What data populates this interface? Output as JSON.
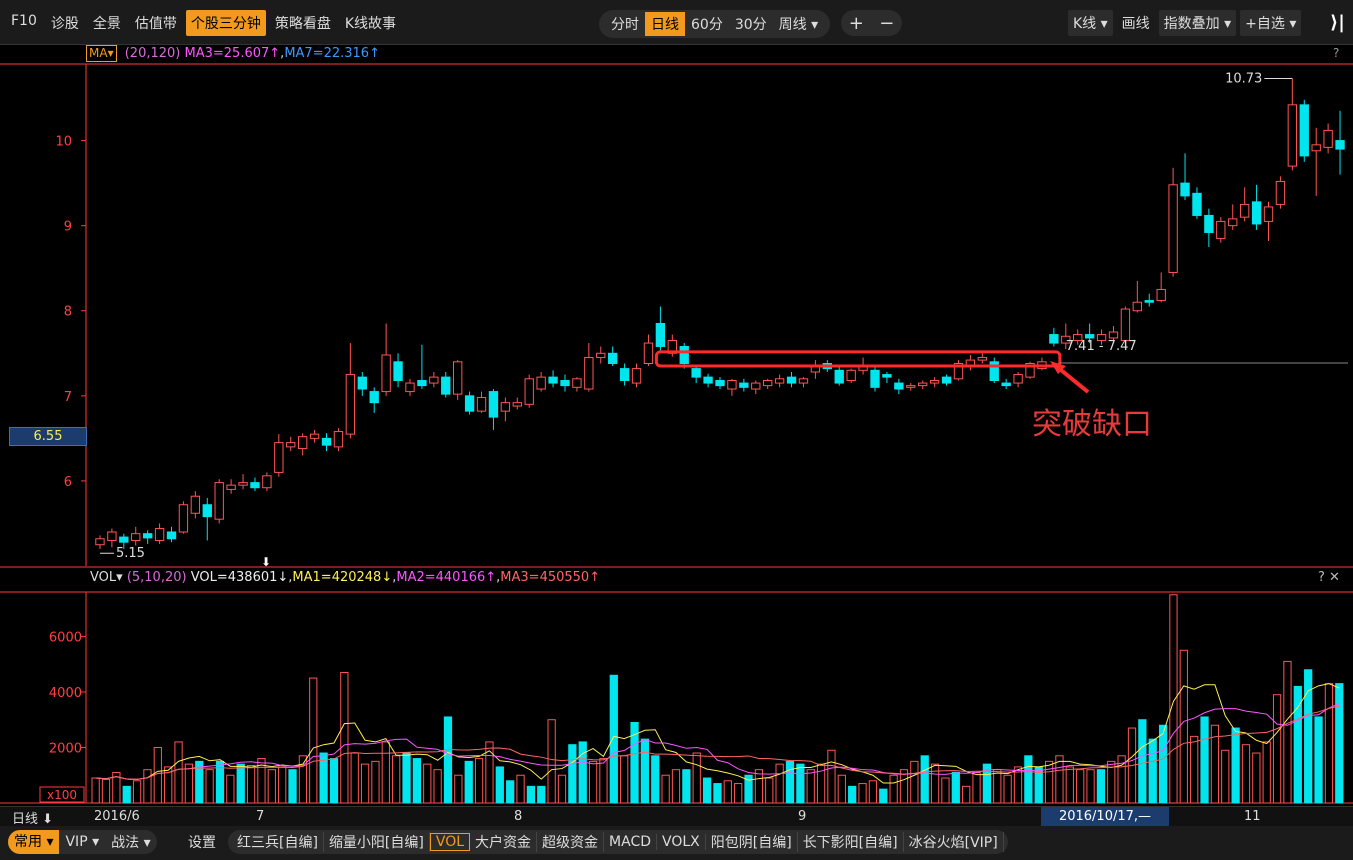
{
  "nav": {
    "items": [
      "F10",
      "诊股",
      "全景",
      "估值带",
      "个股三分钟",
      "策略看盘",
      "K线故事"
    ],
    "active": 4
  },
  "periods": {
    "items": [
      "分时",
      "日线",
      "60分",
      "30分",
      "周线 ▾"
    ],
    "active": 1
  },
  "zoom": {
    "in": "+",
    "out": "−"
  },
  "right_controls": {
    "kline": "K线 ▾",
    "draw": "画线",
    "index_overlay": "指数叠加 ▾",
    "add_watch": "+自选 ▾",
    "collapse": "⟩|"
  },
  "main_chart": {
    "indicator_button": "MA▾",
    "params": "(20,120)",
    "ma3": "MA3=25.607↑",
    "ma7": "MA7=22.316↑",
    "help": "?",
    "current_price_tag": "6.55",
    "high_label": "10.73",
    "low_label": "5.15",
    "gap_label": "7.41 - 7.47",
    "annotation": "突破缺口",
    "colors": {
      "up": "#ff5555",
      "down": "#00e5ee",
      "ma_a": "#ffee55",
      "ma_b": "#ff55ff",
      "ma_c": "#ff6666",
      "axis": "#ff3b3b",
      "gap_box": "#ff2a2a"
    }
  },
  "volume": {
    "label": "VOL▾",
    "params": "(5,10,20)",
    "vol": "VOL=438601↓",
    "ma1": "MA1=420248↓",
    "ma2": "MA2=440166↑",
    "ma3": "MA3=450550↑",
    "controls": "? ✕",
    "unit": "x100"
  },
  "dates": {
    "prefix": "日线 ⬇",
    "start": "2016/6",
    "m7": "7",
    "m8": "8",
    "m9": "9",
    "cursor": "2016/10/17,—",
    "m11": "11"
  },
  "bottom": {
    "group1": [
      "常用 ▾",
      "VIP ▾",
      "战法 ▾"
    ],
    "group1_active": 0,
    "settings": "设置",
    "indicators": [
      "红三兵[自编]",
      "缩量小阳[自编]",
      "VOL",
      "大户资金",
      "超级资金",
      "MACD",
      "VOLX",
      "阳包阴[自编]",
      "长下影阳[自编]",
      "冰谷火焰[VIP]"
    ],
    "indicators_active": 2
  },
  "chart_data": [
    {
      "type": "candlestick",
      "title": "",
      "ylim": [
        5.0,
        10.9
      ],
      "yticks": [
        6,
        7,
        8,
        9,
        10
      ],
      "grid": false,
      "max_annotation": 10.73,
      "min_annotation": 5.15,
      "gap_range": [
        7.41,
        7.47
      ],
      "candles": [
        {
          "o": 5.25,
          "c": 5.32,
          "h": 5.36,
          "l": 5.2
        },
        {
          "o": 5.3,
          "c": 5.4,
          "h": 5.44,
          "l": 5.22
        },
        {
          "o": 5.34,
          "c": 5.28,
          "h": 5.38,
          "l": 5.2
        },
        {
          "o": 5.3,
          "c": 5.38,
          "h": 5.46,
          "l": 5.24
        },
        {
          "o": 5.38,
          "c": 5.33,
          "h": 5.42,
          "l": 5.26
        },
        {
          "o": 5.3,
          "c": 5.44,
          "h": 5.5,
          "l": 5.26
        },
        {
          "o": 5.4,
          "c": 5.32,
          "h": 5.46,
          "l": 5.28
        },
        {
          "o": 5.4,
          "c": 5.72,
          "h": 5.76,
          "l": 5.38
        },
        {
          "o": 5.62,
          "c": 5.82,
          "h": 5.88,
          "l": 5.56
        },
        {
          "o": 5.72,
          "c": 5.58,
          "h": 5.8,
          "l": 5.3
        },
        {
          "o": 5.55,
          "c": 5.98,
          "h": 6.02,
          "l": 5.5
        },
        {
          "o": 5.9,
          "c": 5.95,
          "h": 6.02,
          "l": 5.85
        },
        {
          "o": 5.95,
          "c": 5.98,
          "h": 6.08,
          "l": 5.9
        },
        {
          "o": 5.98,
          "c": 5.92,
          "h": 6.04,
          "l": 5.88
        },
        {
          "o": 5.92,
          "c": 6.06,
          "h": 6.1,
          "l": 5.88
        },
        {
          "o": 6.1,
          "c": 6.45,
          "h": 6.55,
          "l": 6.05
        },
        {
          "o": 6.4,
          "c": 6.45,
          "h": 6.52,
          "l": 6.35
        },
        {
          "o": 6.38,
          "c": 6.52,
          "h": 6.56,
          "l": 6.3
        },
        {
          "o": 6.5,
          "c": 6.55,
          "h": 6.6,
          "l": 6.45
        },
        {
          "o": 6.5,
          "c": 6.42,
          "h": 6.56,
          "l": 6.35
        },
        {
          "o": 6.4,
          "c": 6.58,
          "h": 6.62,
          "l": 6.35
        },
        {
          "o": 6.55,
          "c": 7.25,
          "h": 7.62,
          "l": 6.5
        },
        {
          "o": 7.22,
          "c": 7.08,
          "h": 7.28,
          "l": 7.0
        },
        {
          "o": 7.05,
          "c": 6.92,
          "h": 7.1,
          "l": 6.8
        },
        {
          "o": 7.05,
          "c": 7.48,
          "h": 7.85,
          "l": 7.0
        },
        {
          "o": 7.4,
          "c": 7.18,
          "h": 7.5,
          "l": 7.1
        },
        {
          "o": 7.05,
          "c": 7.15,
          "h": 7.2,
          "l": 7.0
        },
        {
          "o": 7.18,
          "c": 7.12,
          "h": 7.6,
          "l": 7.08
        },
        {
          "o": 7.15,
          "c": 7.22,
          "h": 7.28,
          "l": 7.1
        },
        {
          "o": 7.22,
          "c": 7.02,
          "h": 7.28,
          "l": 6.98
        },
        {
          "o": 7.02,
          "c": 7.4,
          "h": 7.42,
          "l": 6.95
        },
        {
          "o": 7.0,
          "c": 6.82,
          "h": 7.05,
          "l": 6.78
        },
        {
          "o": 6.82,
          "c": 6.98,
          "h": 7.05,
          "l": 6.8
        },
        {
          "o": 7.05,
          "c": 6.75,
          "h": 7.08,
          "l": 6.6
        },
        {
          "o": 6.82,
          "c": 6.92,
          "h": 6.98,
          "l": 6.7
        },
        {
          "o": 6.88,
          "c": 6.92,
          "h": 6.98,
          "l": 6.84
        },
        {
          "o": 6.9,
          "c": 7.2,
          "h": 7.25,
          "l": 6.86
        },
        {
          "o": 7.08,
          "c": 7.22,
          "h": 7.28,
          "l": 7.05
        },
        {
          "o": 7.22,
          "c": 7.15,
          "h": 7.3,
          "l": 7.1
        },
        {
          "o": 7.18,
          "c": 7.12,
          "h": 7.25,
          "l": 7.05
        },
        {
          "o": 7.1,
          "c": 7.2,
          "h": 7.22,
          "l": 7.05
        },
        {
          "o": 7.08,
          "c": 7.45,
          "h": 7.62,
          "l": 7.05
        },
        {
          "o": 7.45,
          "c": 7.5,
          "h": 7.58,
          "l": 7.38
        },
        {
          "o": 7.5,
          "c": 7.38,
          "h": 7.58,
          "l": 7.35
        },
        {
          "o": 7.32,
          "c": 7.18,
          "h": 7.38,
          "l": 7.12
        },
        {
          "o": 7.15,
          "c": 7.32,
          "h": 7.38,
          "l": 7.1
        },
        {
          "o": 7.38,
          "c": 7.62,
          "h": 7.72,
          "l": 7.35
        },
        {
          "o": 7.85,
          "c": 7.58,
          "h": 8.05,
          "l": 7.5
        },
        {
          "o": 7.5,
          "c": 7.65,
          "h": 7.72,
          "l": 7.46
        },
        {
          "o": 7.58,
          "c": 7.38,
          "h": 7.62,
          "l": 7.32
        },
        {
          "o": 7.32,
          "c": 7.22,
          "h": 7.36,
          "l": 7.15
        },
        {
          "o": 7.22,
          "c": 7.15,
          "h": 7.26,
          "l": 7.1
        },
        {
          "o": 7.18,
          "c": 7.12,
          "h": 7.22,
          "l": 7.08
        },
        {
          "o": 7.08,
          "c": 7.18,
          "h": 7.2,
          "l": 7.0
        },
        {
          "o": 7.15,
          "c": 7.1,
          "h": 7.2,
          "l": 7.05
        },
        {
          "o": 7.08,
          "c": 7.15,
          "h": 7.18,
          "l": 7.02
        },
        {
          "o": 7.12,
          "c": 7.18,
          "h": 7.2,
          "l": 7.08
        },
        {
          "o": 7.15,
          "c": 7.2,
          "h": 7.25,
          "l": 7.1
        },
        {
          "o": 7.22,
          "c": 7.15,
          "h": 7.28,
          "l": 7.1
        },
        {
          "o": 7.15,
          "c": 7.2,
          "h": 7.22,
          "l": 7.1
        },
        {
          "o": 7.28,
          "c": 7.35,
          "h": 7.42,
          "l": 7.2
        },
        {
          "o": 7.38,
          "c": 7.32,
          "h": 7.42,
          "l": 7.28
        },
        {
          "o": 7.3,
          "c": 7.15,
          "h": 7.35,
          "l": 7.12
        },
        {
          "o": 7.18,
          "c": 7.3,
          "h": 7.32,
          "l": 7.15
        },
        {
          "o": 7.3,
          "c": 7.35,
          "h": 7.45,
          "l": 7.25
        },
        {
          "o": 7.3,
          "c": 7.1,
          "h": 7.35,
          "l": 7.05
        },
        {
          "o": 7.25,
          "c": 7.22,
          "h": 7.28,
          "l": 7.15
        },
        {
          "o": 7.15,
          "c": 7.08,
          "h": 7.2,
          "l": 7.02
        },
        {
          "o": 7.1,
          "c": 7.12,
          "h": 7.15,
          "l": 7.06
        },
        {
          "o": 7.12,
          "c": 7.15,
          "h": 7.18,
          "l": 7.08
        },
        {
          "o": 7.15,
          "c": 7.18,
          "h": 7.22,
          "l": 7.1
        },
        {
          "o": 7.22,
          "c": 7.15,
          "h": 7.25,
          "l": 7.12
        },
        {
          "o": 7.2,
          "c": 7.38,
          "h": 7.42,
          "l": 7.18
        },
        {
          "o": 7.35,
          "c": 7.42,
          "h": 7.48,
          "l": 7.3
        },
        {
          "o": 7.42,
          "c": 7.45,
          "h": 7.5,
          "l": 7.38
        },
        {
          "o": 7.4,
          "c": 7.18,
          "h": 7.45,
          "l": 7.15
        },
        {
          "o": 7.15,
          "c": 7.12,
          "h": 7.2,
          "l": 7.08
        },
        {
          "o": 7.15,
          "c": 7.25,
          "h": 7.28,
          "l": 7.1
        },
        {
          "o": 7.22,
          "c": 7.38,
          "h": 7.4,
          "l": 7.2
        },
        {
          "o": 7.32,
          "c": 7.4,
          "h": 7.45,
          "l": 7.3
        },
        {
          "o": 7.72,
          "c": 7.62,
          "h": 7.8,
          "l": 7.58
        },
        {
          "o": 7.62,
          "c": 7.7,
          "h": 7.85,
          "l": 7.55
        },
        {
          "o": 7.65,
          "c": 7.72,
          "h": 7.78,
          "l": 7.6
        },
        {
          "o": 7.72,
          "c": 7.68,
          "h": 7.85,
          "l": 7.62
        },
        {
          "o": 7.65,
          "c": 7.72,
          "h": 7.78,
          "l": 7.6
        },
        {
          "o": 7.68,
          "c": 7.75,
          "h": 7.82,
          "l": 7.62
        },
        {
          "o": 7.65,
          "c": 8.02,
          "h": 8.05,
          "l": 7.6
        },
        {
          "o": 8.0,
          "c": 8.1,
          "h": 8.35,
          "l": 7.98
        },
        {
          "o": 8.12,
          "c": 8.1,
          "h": 8.2,
          "l": 8.05
        },
        {
          "o": 8.12,
          "c": 8.25,
          "h": 8.45,
          "l": 8.1
        },
        {
          "o": 8.45,
          "c": 9.48,
          "h": 9.68,
          "l": 8.4
        },
        {
          "o": 9.5,
          "c": 9.35,
          "h": 9.85,
          "l": 9.3
        },
        {
          "o": 9.38,
          "c": 9.12,
          "h": 9.45,
          "l": 9.08
        },
        {
          "o": 9.12,
          "c": 8.92,
          "h": 9.2,
          "l": 8.75
        },
        {
          "o": 8.85,
          "c": 9.05,
          "h": 9.1,
          "l": 8.8
        },
        {
          "o": 9.0,
          "c": 9.08,
          "h": 9.25,
          "l": 8.95
        },
        {
          "o": 9.1,
          "c": 9.25,
          "h": 9.45,
          "l": 9.05
        },
        {
          "o": 9.28,
          "c": 9.02,
          "h": 9.48,
          "l": 8.95
        },
        {
          "o": 9.05,
          "c": 9.22,
          "h": 9.28,
          "l": 8.82
        },
        {
          "o": 9.25,
          "c": 9.52,
          "h": 9.58,
          "l": 9.2
        },
        {
          "o": 9.7,
          "c": 10.42,
          "h": 10.73,
          "l": 9.65
        },
        {
          "o": 10.42,
          "c": 9.82,
          "h": 10.48,
          "l": 9.75
        },
        {
          "o": 9.88,
          "c": 9.95,
          "h": 10.15,
          "l": 9.35
        },
        {
          "o": 9.92,
          "c": 10.12,
          "h": 10.2,
          "l": 9.85
        },
        {
          "o": 10.0,
          "c": 9.9,
          "h": 10.35,
          "l": 9.6
        }
      ],
      "ma_a": [
        5.22,
        5.28,
        5.3,
        5.34,
        5.38,
        5.45,
        5.55,
        5.66,
        5.78,
        5.88,
        5.96,
        6.05,
        6.15,
        6.27,
        6.38,
        6.5,
        6.62,
        6.74,
        6.82,
        6.88,
        6.94,
        6.98,
        7.02,
        7.05,
        7.07,
        7.08,
        7.08,
        7.09,
        7.1,
        7.12,
        7.14,
        7.16,
        7.18,
        7.2,
        7.22,
        7.23,
        7.24,
        7.25,
        7.25,
        7.24,
        7.23,
        7.22,
        7.21,
        7.2,
        7.2,
        7.2,
        7.21,
        7.22,
        7.23,
        7.24,
        7.25,
        7.27,
        7.3,
        7.34,
        7.38,
        7.45,
        7.55,
        7.66,
        7.78,
        7.9,
        8.02,
        8.15,
        8.3,
        8.45,
        8.6,
        8.75,
        8.9,
        9.04,
        9.18,
        9.32,
        9.45,
        9.56,
        9.65,
        9.72,
        9.78,
        9.84,
        9.88,
        9.92,
        9.95,
        9.97
      ],
      "ma_b": [
        5.4,
        5.42,
        5.45,
        5.48,
        5.52,
        5.57,
        5.63,
        5.7,
        5.78,
        5.86,
        5.94,
        6.02,
        6.1,
        6.18,
        6.26,
        6.34,
        6.42,
        6.5,
        6.57,
        6.63,
        6.69,
        6.74,
        6.78,
        6.82,
        6.86,
        6.89,
        6.92,
        6.95,
        6.97,
        6.99,
        7.01,
        7.03,
        7.05,
        7.07,
        7.09,
        7.11,
        7.12,
        7.13,
        7.14,
        7.15,
        7.16,
        7.17,
        7.18,
        7.19,
        7.2,
        7.21,
        7.22,
        7.23,
        7.24,
        7.25,
        7.26,
        7.27,
        7.28,
        7.3,
        7.32,
        7.35,
        7.39,
        7.44,
        7.5,
        7.57,
        7.65,
        7.74,
        7.84,
        7.95,
        8.06,
        8.18,
        8.3,
        8.42,
        8.54,
        8.66,
        8.78,
        8.9,
        9.01,
        9.11,
        9.2,
        9.28,
        9.36,
        9.43,
        9.49,
        9.55
      ]
    },
    {
      "type": "bar",
      "title": "",
      "ylim": [
        0,
        7600
      ],
      "yticks": [
        2000,
        4000,
        6000
      ],
      "unit": "x100",
      "grid": false,
      "values": [
        900,
        850,
        1100,
        600,
        800,
        1200,
        2000,
        1300,
        2200,
        1400,
        1500,
        1200,
        1500,
        1000,
        1400,
        1350,
        1600,
        1200,
        1300,
        1200,
        1700,
        4500,
        1800,
        1600,
        4700,
        1800,
        1400,
        1500,
        2200,
        1700,
        1800,
        1600,
        1400,
        1200,
        3100,
        1000,
        1500,
        1600,
        2200,
        1300,
        800,
        1000,
        600,
        600,
        3000,
        1000,
        2100,
        2200,
        1500,
        1600,
        4600,
        1700,
        2900,
        2300,
        1700,
        1000,
        1200,
        1200,
        1800,
        900,
        700,
        800,
        700,
        1000,
        1200,
        900,
        1400,
        1500,
        1400,
        1200,
        1400,
        1900,
        1000,
        600,
        700,
        800,
        500,
        1000,
        1200,
        1500,
        1700,
        1400,
        900,
        1100,
        600,
        1100,
        1400,
        1200,
        1000,
        1300,
        1700,
        1300,
        1500,
        1700,
        1300,
        1200,
        1200,
        1200,
        1500,
        1700,
        2700,
        3000,
        2300,
        2800,
        7500,
        5500,
        2400,
        3100,
        2800,
        1900,
        2700,
        2100,
        1800,
        2200,
        3900,
        5100,
        4200,
        4800,
        3100,
        4300,
        4300
      ],
      "up_flags": [
        1,
        1,
        1,
        0,
        1,
        1,
        1,
        1,
        1,
        1,
        0,
        1,
        0,
        1,
        0,
        1,
        1,
        1,
        1,
        0,
        1,
        1,
        0,
        0,
        1,
        1,
        1,
        1,
        1,
        1,
        0,
        0,
        1,
        1,
        0,
        1,
        0,
        1,
        1,
        0,
        0,
        1,
        0,
        0,
        1,
        1,
        0,
        0,
        1,
        1,
        0,
        1,
        0,
        0,
        0,
        1,
        1,
        0,
        1,
        0,
        0,
        1,
        1,
        0,
        1,
        1,
        1,
        0,
        0,
        1,
        1,
        1,
        1,
        0,
        1,
        1,
        0,
        1,
        1,
        1,
        0,
        1,
        1,
        0,
        1,
        1,
        0,
        1,
        1,
        1,
        0,
        0,
        1,
        1,
        1,
        1,
        1,
        0,
        1,
        1,
        1,
        0,
        0,
        0,
        1,
        1,
        1,
        0,
        1,
        1,
        0,
        1,
        1,
        1,
        1,
        1,
        0,
        0,
        0,
        1,
        0,
        1
      ]
    }
  ]
}
